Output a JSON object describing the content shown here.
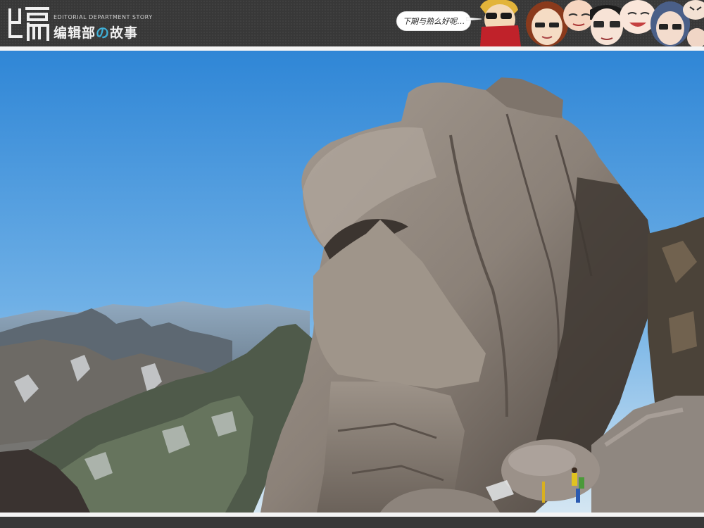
{
  "header": {
    "logo_en": "EDITORIAL DEPARTMENT STORY",
    "logo_cn_prefix": "编辑部",
    "logo_cn_mid": "の",
    "logo_cn_suffix": "故事",
    "bubble_text": "下期与熟么好呢…",
    "accent_color": "#3fb0d8",
    "bar_color": "#383838"
  },
  "photo": {
    "subject": "huangshan-granite-rock",
    "sky_top": "#2f86d6",
    "sky_bottom": "#cfe3f1"
  }
}
